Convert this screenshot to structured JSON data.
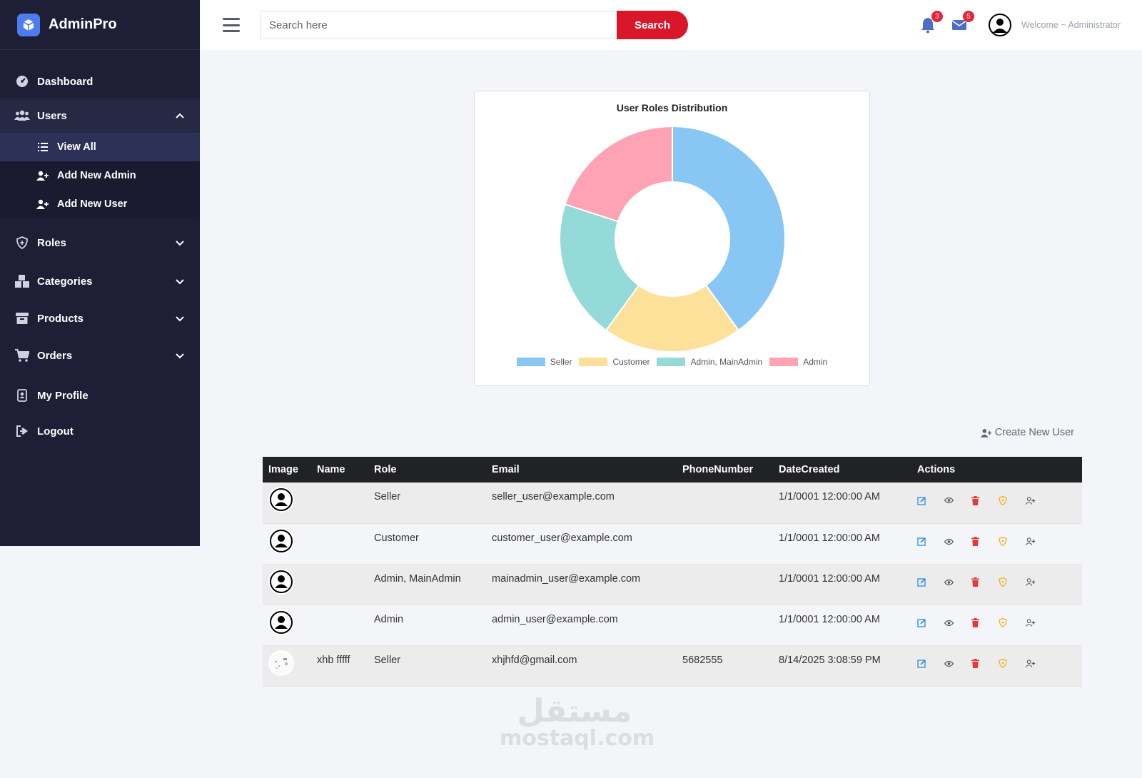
{
  "brand": {
    "name": "AdminPro",
    "accent": "#4d7cf0"
  },
  "sidebar": {
    "items": [
      {
        "label": "Dashboard",
        "icon": "gauge-icon"
      },
      {
        "label": "Users",
        "icon": "users-icon",
        "open": true,
        "children": [
          {
            "label": "View All",
            "icon": "list-icon",
            "active": true
          },
          {
            "label": "Add New Admin",
            "icon": "user-plus-icon"
          },
          {
            "label": "Add New User",
            "icon": "user-plus-icon"
          }
        ]
      },
      {
        "label": "Roles",
        "icon": "shield-icon"
      },
      {
        "label": "Categories",
        "icon": "boxes-icon"
      },
      {
        "label": "Products",
        "icon": "box-icon"
      },
      {
        "label": "Orders",
        "icon": "cart-icon"
      },
      {
        "label": "My Profile",
        "icon": "id-badge-icon"
      },
      {
        "label": "Logout",
        "icon": "logout-icon"
      }
    ]
  },
  "header": {
    "search_placeholder": "Search here",
    "search_label": "Search",
    "notifications_count": "3",
    "messages_count": "5",
    "welcome": "Welcome ~ Administrator"
  },
  "chart_data": {
    "type": "pie",
    "title": "User Roles Distribution",
    "categories": [
      "Seller",
      "Customer",
      "Admin, MainAdmin",
      "Admin"
    ],
    "values": [
      2,
      1,
      1,
      1
    ],
    "colors": [
      "#88c6f4",
      "#fde09a",
      "#93dad8",
      "#fda3b4"
    ],
    "donut": true,
    "legend": "bottom"
  },
  "create_link": "Create New User",
  "table": {
    "columns": [
      "Image",
      "Name",
      "Role",
      "Email",
      "PhoneNumber",
      "DateCreated",
      "Actions"
    ],
    "rows": [
      {
        "name": "",
        "role": "Seller",
        "email": "seller_user@example.com",
        "phone": "",
        "date": "1/1/0001 12:00:00 AM"
      },
      {
        "name": "",
        "role": "Customer",
        "email": "customer_user@example.com",
        "phone": "",
        "date": "1/1/0001 12:00:00 AM"
      },
      {
        "name": "",
        "role": "Admin, MainAdmin",
        "email": "mainadmin_user@example.com",
        "phone": "",
        "date": "1/1/0001 12:00:00 AM"
      },
      {
        "name": "",
        "role": "Admin",
        "email": "admin_user@example.com",
        "phone": "",
        "date": "1/1/0001 12:00:00 AM"
      },
      {
        "name": "xhb fffff",
        "role": "Seller",
        "email": "xhjhfd@gmail.com",
        "phone": "5682555",
        "date": "8/14/2025 3:08:59 PM"
      }
    ]
  },
  "watermark": {
    "arabic": "مستقل",
    "latin": "mostaql.com"
  }
}
